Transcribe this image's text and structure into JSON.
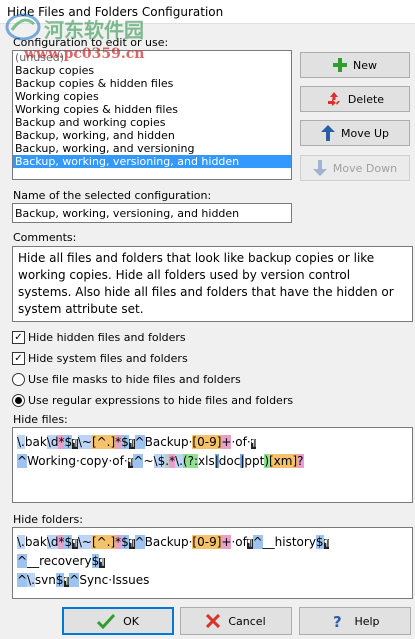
{
  "window": {
    "title": "Hide Files and Folders Configuration"
  },
  "watermark": {
    "text": "河东软件园",
    "url": "www.pc0359.cn"
  },
  "config_list": {
    "label": "Configuration to edit or use:",
    "items": [
      "(unused)",
      "Backup copies",
      "Backup copies & hidden files",
      "Working copies",
      "Working copies & hidden files",
      "Backup and working copies",
      "Backup, working, and hidden",
      "Backup, working, and versioning",
      "Backup, working, versioning, and hidden"
    ],
    "selected_index": 8
  },
  "buttons": {
    "new": "New",
    "delete": "Delete",
    "move_up": "Move Up",
    "move_down": "Move Down",
    "ok": "OK",
    "cancel": "Cancel",
    "help": "Help"
  },
  "name_field": {
    "label": "Name of the selected configuration:",
    "value": "Backup, working, versioning, and hidden"
  },
  "comments": {
    "label": "Comments:",
    "text": "Hide all files and folders that look like backup copies or like working copies.  Hide all folders used by version control systems.  Also hide all files and folders that have the hidden or system attribute set."
  },
  "options": {
    "hide_hidden": {
      "label": "Hide hidden files and folders",
      "checked": true
    },
    "hide_system": {
      "label": "Hide system files and folders",
      "checked": true
    },
    "use_masks": {
      "label": "Use file masks to hide files and folders",
      "selected": false
    },
    "use_regex": {
      "label": "Use regular expressions to hide files and folders",
      "selected": true
    }
  },
  "hide_files": {
    "label": "Hide files:",
    "lines": [
      [
        {
          "t": "\\.",
          "k": "esc"
        },
        {
          "t": "bak",
          "k": "lit"
        },
        {
          "t": "\\d",
          "k": "esc"
        },
        {
          "t": "*",
          "k": "quant"
        },
        {
          "t": "$",
          "k": "anchor"
        },
        {
          "t": "¶",
          "k": "eol"
        },
        {
          "t": "\\~",
          "k": "esc"
        },
        {
          "t": "[^.]",
          "k": "class"
        },
        {
          "t": "*",
          "k": "quant"
        },
        {
          "t": "$",
          "k": "anchor"
        },
        {
          "t": "¶",
          "k": "eol"
        },
        {
          "t": "^",
          "k": "anchor"
        },
        {
          "t": "Backup·",
          "k": "lit"
        },
        {
          "t": "[0-9]",
          "k": "class"
        },
        {
          "t": "+",
          "k": "quant"
        },
        {
          "t": "·of·",
          "k": "lit"
        },
        {
          "t": "¶",
          "k": "eol"
        }
      ],
      [
        {
          "t": "^",
          "k": "anchor"
        },
        {
          "t": "Working·copy·of·",
          "k": "lit"
        },
        {
          "t": "¶",
          "k": "eol"
        },
        {
          "t": "^",
          "k": "anchor"
        },
        {
          "t": "~",
          "k": "lit"
        },
        {
          "t": "\\$",
          "k": "esc"
        },
        {
          "t": ".",
          "k": "any"
        },
        {
          "t": "*",
          "k": "quant"
        },
        {
          "t": "\\.",
          "k": "esc"
        },
        {
          "t": "(?:",
          "k": "group"
        },
        {
          "t": "xls",
          "k": "lit"
        },
        {
          "t": "|",
          "k": "alt"
        },
        {
          "t": "doc",
          "k": "lit"
        },
        {
          "t": "|",
          "k": "alt"
        },
        {
          "t": "ppt",
          "k": "lit"
        },
        {
          "t": ")",
          "k": "group"
        },
        {
          "t": "[xm]",
          "k": "class"
        },
        {
          "t": "?",
          "k": "quant"
        }
      ]
    ]
  },
  "hide_folders": {
    "label": "Hide folders:",
    "lines": [
      [
        {
          "t": "\\.",
          "k": "esc"
        },
        {
          "t": "bak",
          "k": "lit"
        },
        {
          "t": "\\d",
          "k": "esc"
        },
        {
          "t": "*",
          "k": "quant"
        },
        {
          "t": "$",
          "k": "anchor"
        },
        {
          "t": "¶",
          "k": "eol"
        },
        {
          "t": "\\~",
          "k": "esc"
        },
        {
          "t": "[^.]",
          "k": "class"
        },
        {
          "t": "*",
          "k": "quant"
        },
        {
          "t": "$",
          "k": "anchor"
        },
        {
          "t": "¶",
          "k": "eol"
        },
        {
          "t": "^",
          "k": "anchor"
        },
        {
          "t": "Backup·",
          "k": "lit"
        },
        {
          "t": "[0-9]",
          "k": "class"
        },
        {
          "t": "+",
          "k": "quant"
        },
        {
          "t": "·of",
          "k": "lit"
        },
        {
          "t": "¶",
          "k": "eol"
        },
        {
          "t": "^",
          "k": "anchor"
        },
        {
          "t": "__history",
          "k": "lit"
        },
        {
          "t": "$",
          "k": "anchor"
        },
        {
          "t": "¶",
          "k": "eol"
        }
      ],
      [
        {
          "t": "^",
          "k": "anchor"
        },
        {
          "t": "__recovery",
          "k": "lit"
        },
        {
          "t": "$",
          "k": "anchor"
        },
        {
          "t": "¶",
          "k": "eol"
        }
      ],
      [
        {
          "t": "^",
          "k": "anchor"
        },
        {
          "t": "\\.",
          "k": "esc"
        },
        {
          "t": "svn",
          "k": "lit"
        },
        {
          "t": "$",
          "k": "anchor"
        },
        {
          "t": "¶",
          "k": "eol"
        },
        {
          "t": "^",
          "k": "anchor"
        },
        {
          "t": "Sync·Issues",
          "k": "lit"
        }
      ]
    ]
  },
  "colors": {
    "selection": "#3399ff",
    "new_icon": "#2e9e2e",
    "delete_icon": "#d9342b",
    "arrow_icon": "#2a5fa8"
  }
}
